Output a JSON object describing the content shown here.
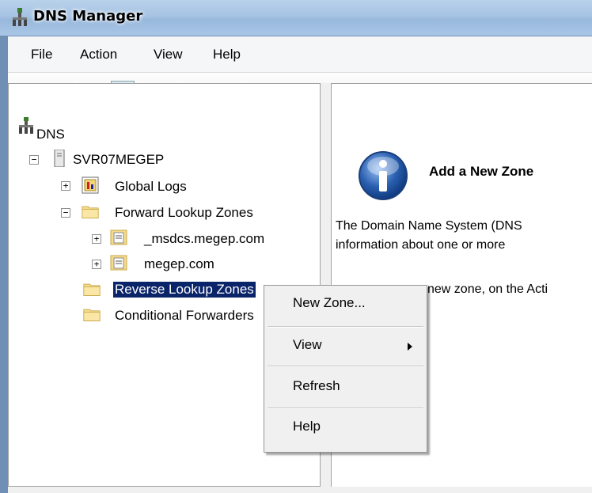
{
  "window": {
    "title": "DNS Manager"
  },
  "menubar": [
    "File",
    "Action",
    "View",
    "Help"
  ],
  "tree": {
    "root": "DNS",
    "server": "SVR07MEGEP",
    "global_logs": "Global Logs",
    "forward_zones": "Forward Lookup Zones",
    "zone_msdcs": "_msdcs.megep.com",
    "zone_megep": "megep.com",
    "reverse_zones": "Reverse Lookup Zones",
    "conditional_forwarders": "Conditional Forwarders"
  },
  "info": {
    "title": "Add a New Zone",
    "line1": "The Domain Name System (DNS",
    "line2": "information about one or more",
    "line3": "new zone, on the Acti"
  },
  "context_menu": {
    "items": [
      "New Zone...",
      "View",
      "Refresh",
      "Help"
    ]
  },
  "colors": {
    "selection": "#0a246a",
    "title_bar": "#a6c3e3",
    "info_icon": "#2a5fb0"
  }
}
